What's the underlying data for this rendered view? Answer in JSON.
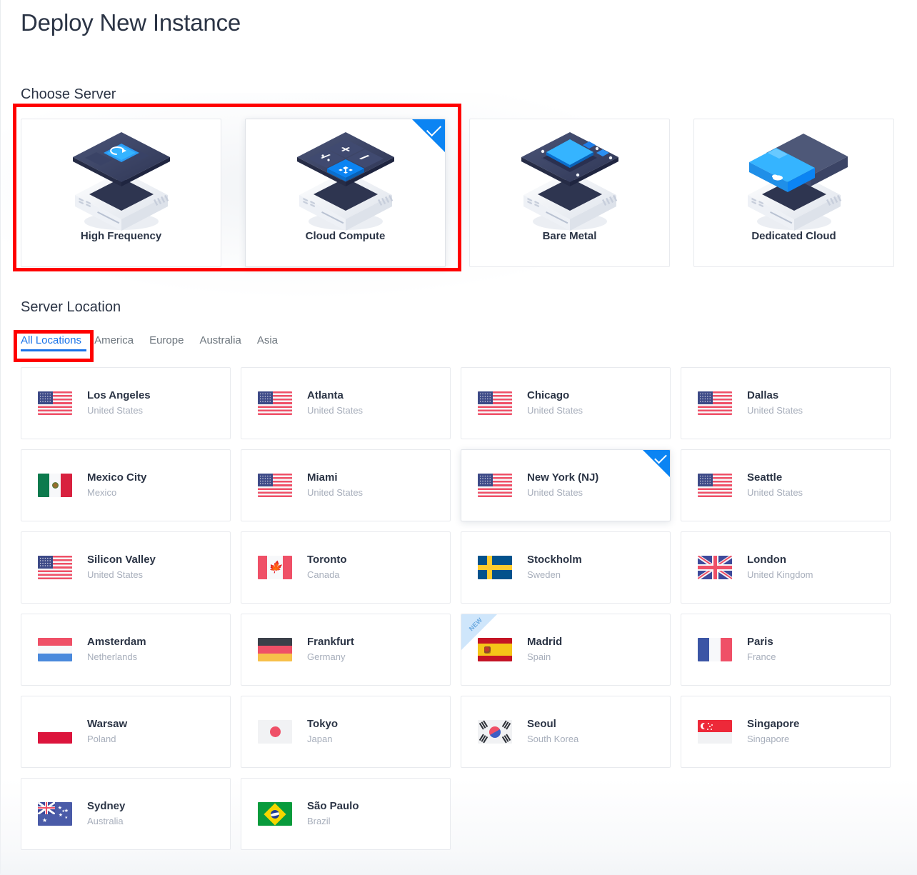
{
  "page": {
    "title": "Deploy New Instance"
  },
  "choose_server": {
    "section_title": "Choose Server",
    "options": [
      {
        "label": "High Frequency",
        "art": "high-frequency",
        "selected": false
      },
      {
        "label": "Cloud Compute",
        "art": "cloud-compute",
        "selected": true
      },
      {
        "label": "Bare Metal",
        "art": "bare-metal",
        "selected": false
      },
      {
        "label": "Dedicated Cloud",
        "art": "dedicated-cloud",
        "selected": false
      }
    ]
  },
  "server_location": {
    "section_title": "Server Location",
    "tabs": [
      {
        "label": "All Locations",
        "active": true
      },
      {
        "label": "America",
        "active": false
      },
      {
        "label": "Europe",
        "active": false
      },
      {
        "label": "Australia",
        "active": false
      },
      {
        "label": "Asia",
        "active": false
      }
    ],
    "locations": [
      {
        "city": "Los Angeles",
        "country": "United States",
        "flag": "us",
        "selected": false,
        "badge": null
      },
      {
        "city": "Atlanta",
        "country": "United States",
        "flag": "us",
        "selected": false,
        "badge": null
      },
      {
        "city": "Chicago",
        "country": "United States",
        "flag": "us",
        "selected": false,
        "badge": null
      },
      {
        "city": "Dallas",
        "country": "United States",
        "flag": "us",
        "selected": false,
        "badge": null
      },
      {
        "city": "Mexico City",
        "country": "Mexico",
        "flag": "mx",
        "selected": false,
        "badge": null
      },
      {
        "city": "Miami",
        "country": "United States",
        "flag": "us",
        "selected": false,
        "badge": null
      },
      {
        "city": "New York (NJ)",
        "country": "United States",
        "flag": "us",
        "selected": true,
        "badge": null
      },
      {
        "city": "Seattle",
        "country": "United States",
        "flag": "us",
        "selected": false,
        "badge": null
      },
      {
        "city": "Silicon Valley",
        "country": "United States",
        "flag": "us",
        "selected": false,
        "badge": null
      },
      {
        "city": "Toronto",
        "country": "Canada",
        "flag": "ca",
        "selected": false,
        "badge": null
      },
      {
        "city": "Stockholm",
        "country": "Sweden",
        "flag": "se",
        "selected": false,
        "badge": null
      },
      {
        "city": "London",
        "country": "United Kingdom",
        "flag": "gb",
        "selected": false,
        "badge": null
      },
      {
        "city": "Amsterdam",
        "country": "Netherlands",
        "flag": "nl",
        "selected": false,
        "badge": null
      },
      {
        "city": "Frankfurt",
        "country": "Germany",
        "flag": "de",
        "selected": false,
        "badge": null
      },
      {
        "city": "Madrid",
        "country": "Spain",
        "flag": "es",
        "selected": false,
        "badge": "NEW"
      },
      {
        "city": "Paris",
        "country": "France",
        "flag": "fr",
        "selected": false,
        "badge": null
      },
      {
        "city": "Warsaw",
        "country": "Poland",
        "flag": "pl",
        "selected": false,
        "badge": null
      },
      {
        "city": "Tokyo",
        "country": "Japan",
        "flag": "jp",
        "selected": false,
        "badge": null
      },
      {
        "city": "Seoul",
        "country": "South Korea",
        "flag": "kr",
        "selected": false,
        "badge": null
      },
      {
        "city": "Singapore",
        "country": "Singapore",
        "flag": "sg",
        "selected": false,
        "badge": null
      },
      {
        "city": "Sydney",
        "country": "Australia",
        "flag": "au",
        "selected": false,
        "badge": null
      },
      {
        "city": "São Paulo",
        "country": "Brazil",
        "flag": "br",
        "selected": false,
        "badge": null
      }
    ]
  },
  "annotations": [
    {
      "name": "server-type-highlight",
      "color": "#ff0000"
    },
    {
      "name": "all-locations-tab-highlight",
      "color": "#ff0000"
    }
  ],
  "colors": {
    "accent": "#0b84f3",
    "tab_active": "#1a73e8",
    "annotation": "#ff0000",
    "text_primary": "#2b3445",
    "text_muted": "#a7aebb"
  }
}
